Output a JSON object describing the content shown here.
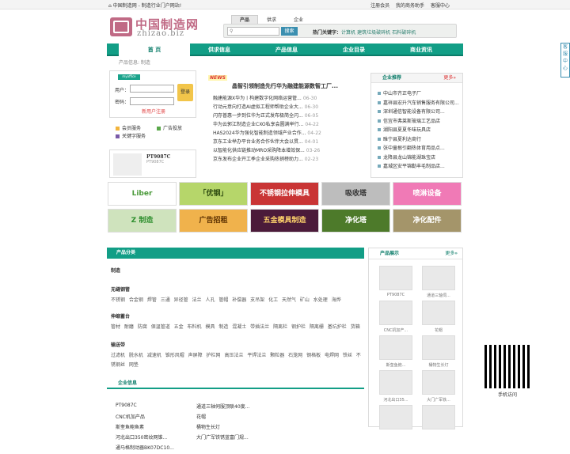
{
  "topbar": {
    "home": "中国制造网 - 制造行业门户网站!",
    "links": [
      "注册会员",
      "我的商务助手",
      "客服中心"
    ]
  },
  "logo": {
    "cn": "中国制造网",
    "en": "zhizao.biz"
  },
  "search": {
    "tabs": [
      "产品",
      "供求",
      "企业"
    ],
    "button": "搜索",
    "hot_label": "热门关键字：",
    "hot": [
      "计算机",
      "建筑垃圾破碎机",
      "石料破碎机"
    ]
  },
  "nav": [
    "首 页",
    "供求信息",
    "产品信息",
    "企业目录",
    "商业资讯"
  ],
  "crumb": "产品信息: 制造",
  "login": {
    "badge": "myoffice",
    "user": "用户：",
    "pass": "密码：",
    "btn": "登录",
    "reg": "新用户注册"
  },
  "services": [
    "会员服务",
    "广告投放",
    "关键字服务"
  ],
  "product_card": {
    "title": "PT9087C",
    "sub": "PT9087C"
  },
  "news": {
    "badge": "NEWS",
    "headline": "晶智引领制造先行华为融建能源数智工厂...",
    "items": [
      {
        "t": "融建能源X华为丨构建数字化网络运营管...",
        "d": "06-30"
      },
      {
        "t": "行动元意向打造AI虚拟工程师帮助企业大...",
        "d": "06-30"
      },
      {
        "t": "闪存普惠一步到位华为正式发布极简全闪...",
        "d": "06-05"
      },
      {
        "t": "华为云郭江制造企业CXO私享会圆满举行...",
        "d": "04-22"
      },
      {
        "t": "HAS2024华为强化智能制造领域产业合作...",
        "d": "04-22"
      },
      {
        "t": "京东工业举办平台业务合作伙伴大会以贯...",
        "d": "04-01"
      },
      {
        "t": "以智能化供应链推动MRO采购降本增效保...",
        "d": "03-26"
      },
      {
        "t": "京东发布企业开工季企业采购热销榜助力...",
        "d": "02-23"
      }
    ]
  },
  "rec": {
    "title": "企业推荐",
    "more": "更多»",
    "items": [
      "中山市齐正电子厂",
      "嘉祥县宏升汽车销售服务有限公司...",
      "深圳通信智能设备有限公司...",
      "信宜市弗莱斯玻璃工艺品店",
      "湖阳县夏夏冬味玩具店",
      "睢宁县夏利达商行",
      "张中童根引翻热体育用品点...",
      "龙降县龙山锦能湖珠宝店",
      "嘉城区安平锦勤丰毛制品店..."
    ]
  },
  "ads": [
    {
      "text": "Liber",
      "bg": "#ffffff",
      "fg": "#4a9a3a"
    },
    {
      "text": "「优钢」",
      "bg": "#b6d66a",
      "fg": "#2d4a10"
    },
    {
      "text": "不锈钢拉伸模具",
      "bg": "#c93535",
      "fg": "#ffffff"
    },
    {
      "text": "吸收塔",
      "bg": "#bdbdbd",
      "fg": "#333333"
    },
    {
      "text": "喷淋设备",
      "bg": "#f07ab6",
      "fg": "#ffffff"
    },
    {
      "text": "Z 制造",
      "bg": "#cfe3bd",
      "fg": "#2f8f2f"
    },
    {
      "text": "广告招租",
      "bg": "#f0b24c",
      "fg": "#5a2f00"
    },
    {
      "text": "五金模具制造",
      "bg": "#4b1b3a",
      "fg": "#ffd36b"
    },
    {
      "text": "净化塔",
      "bg": "#4d7a2a",
      "fg": "#ffffff"
    },
    {
      "text": "净化配件",
      "bg": "#a4956a",
      "fg": "#ffffff"
    }
  ],
  "category": {
    "title": "产品分类",
    "groups": [
      {
        "title": "制造",
        "items": ""
      },
      {
        "title": "无缝钢管",
        "items": "不锈钢 合金钢 焊管 三通 异径管 法兰 人孔 管帽 补偿器 支吊架 化工 天然气 矿山 水处理 海烨"
      },
      {
        "title": "伸缩蓄台",
        "items": "管材 耐磨 防腐 保温管道 五金 布料机 模具 制造 混凝土 带插法兰 隔离栏 钢护栏 隔离栅 基坑护栏 货箱"
      },
      {
        "title": "输送带",
        "items": "过滤机 脱水机 减速机 锥形风帽 声屏障 护栏网 高压法兰 平焊法兰 颗粒器 石笼网 钢格板 电焊网 铁丝 不锈钢丝 网垫"
      }
    ]
  },
  "ent": {
    "title": "企业信息",
    "items": [
      "PT9087C",
      "通道三轴伺服顶联40度...",
      "CNC机加产品",
      "花帽",
      "斯奎鱼鲍鱼素",
      "桶物生长灯",
      "河北出口350密纹网锥...",
      "大门广军铁锈蓝富门规...",
      "通马格制动器BK07DC10..."
    ]
  },
  "show": {
    "title": "产品展示",
    "more": "更多»",
    "items": [
      "PT9087C",
      "通道三轴伺...",
      "CNC机加产...",
      "花帽",
      "斯奎鱼鲍...",
      "桶物生长灯",
      "河北出口35...",
      "大门广军铁...",
      "",
      ""
    ]
  },
  "qr": "手机访问",
  "side": "客服中心"
}
